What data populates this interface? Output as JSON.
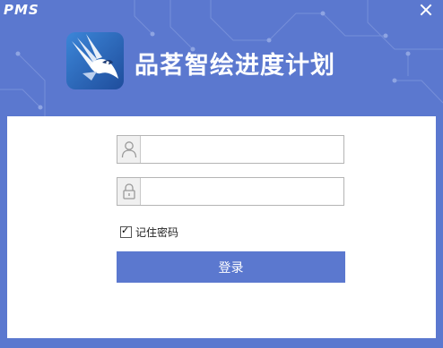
{
  "window": {
    "brand_label": "PMS",
    "app_title": "品茗智绘进度计划"
  },
  "login_form": {
    "username_value": "",
    "password_value": "",
    "remember_label": "记住密码",
    "remember_checked": true,
    "login_label": "登录"
  },
  "icons": [
    "close-icon",
    "bird-logo-icon",
    "user-icon",
    "lock-icon",
    "checkbox-check-icon"
  ],
  "colors": {
    "header_bg": "#5b78cf",
    "panel_bg": "#ffffff",
    "button_bg": "#5b78cf",
    "logo_bg": "#2f67bd"
  }
}
